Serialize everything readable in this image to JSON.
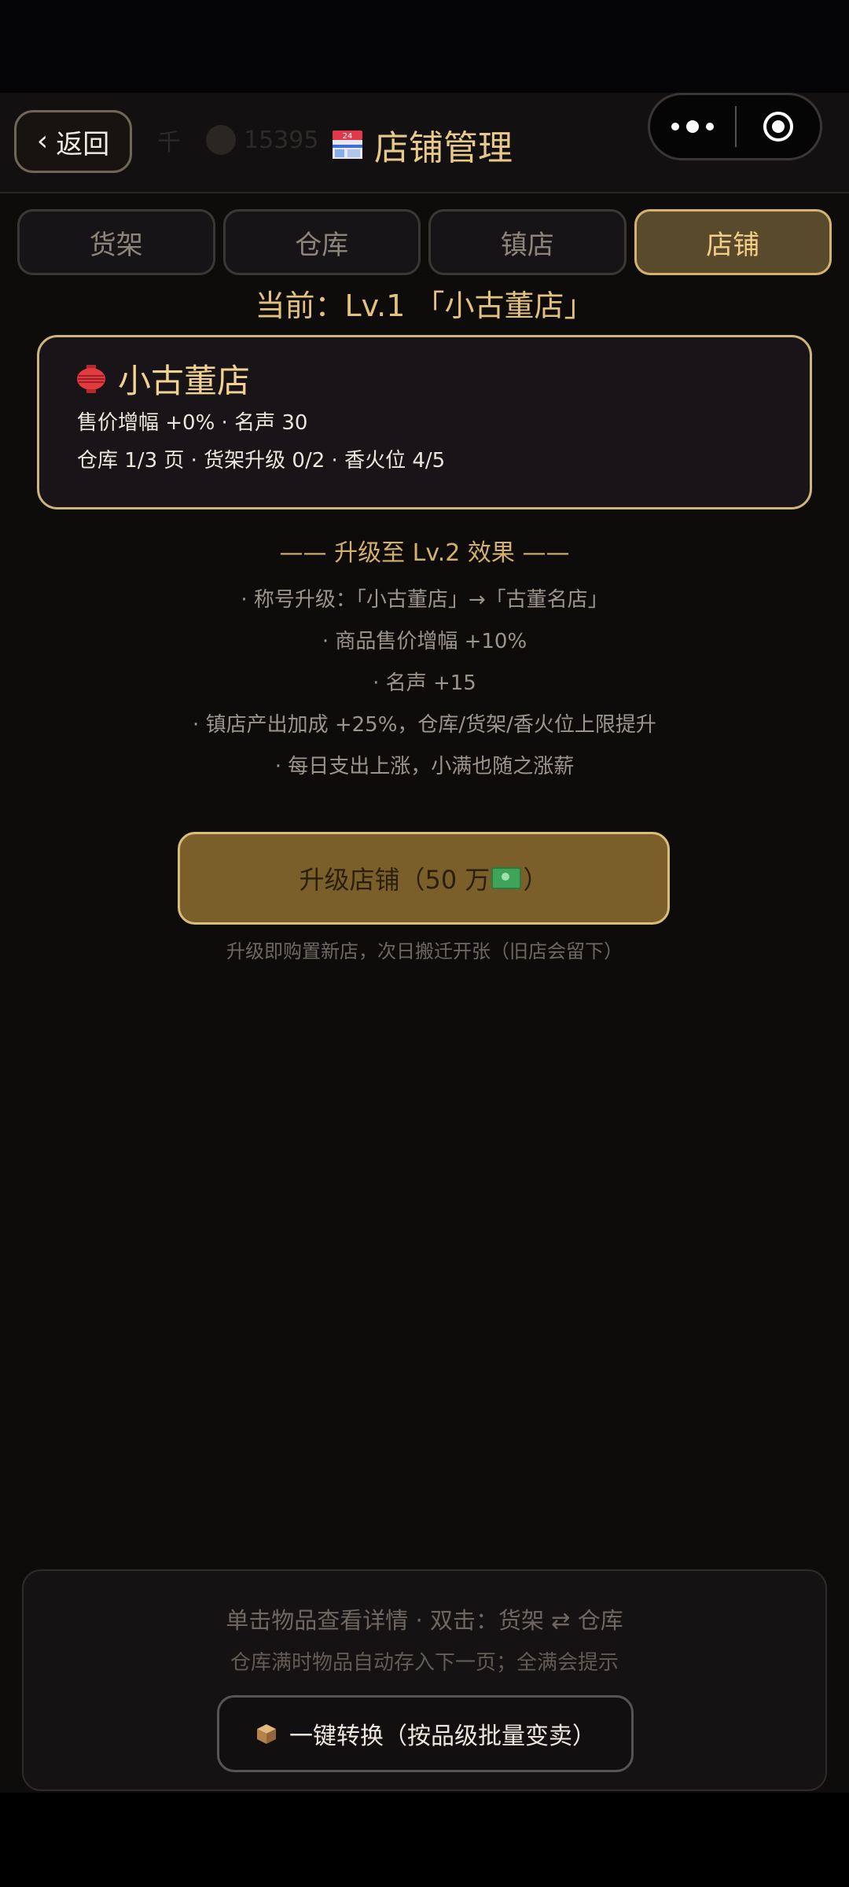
{
  "header": {
    "back_label": "返回",
    "title": "店铺管理",
    "ghost_text_1": "千",
    "ghost_number": "15395"
  },
  "tabs": [
    {
      "label": "货架",
      "active": false
    },
    {
      "label": "仓库",
      "active": false
    },
    {
      "label": "镇店",
      "active": false
    },
    {
      "label": "店铺",
      "active": true
    }
  ],
  "current_level": "当前：Lv.1 「小古董店」",
  "level_card": {
    "name": "小古董店",
    "line1": "售价增幅 +0% · 名声 30",
    "line2": "仓库 1/3 页 · 货架升级 0/2 · 香火位 4/5"
  },
  "upgrade": {
    "header": "—— 升级至 Lv.2 效果 ——",
    "effects": [
      "· 称号升级：「小古董店」→「古董名店」",
      "· 商品售价增幅 +10%",
      "· 名声 +15",
      "· 镇店产出加成 +25%，仓库/货架/香火位上限提升",
      "· 每日支出上涨，小满也随之涨薪"
    ],
    "button_label_prefix": "升级店铺（50 万",
    "button_label_suffix": "）",
    "note": "升级即购置新店，次日搬迁开张（旧店会留下）"
  },
  "bottom": {
    "tip1": "单击物品查看详情 · 双击：货架 ⇄ 仓库",
    "tip2": "仓库满时物品自动存入下一页；全满会提示",
    "convert_label": "一键转换（按品级批量变卖）"
  },
  "colors": {
    "accent_gold": "#e3c17f",
    "active_tab_bg": "#5a4a2c",
    "upgrade_btn_bg": "#7b5f2a",
    "background": "#0e0b0b"
  }
}
